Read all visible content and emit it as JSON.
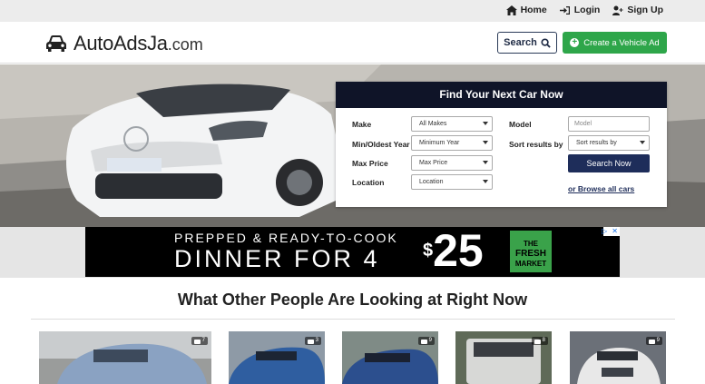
{
  "topbar": {
    "home": "Home",
    "login": "Login",
    "signup": "Sign Up"
  },
  "header": {
    "brand": "AutoAdsJa",
    "tld": ".com",
    "search_label": "Search",
    "create_label": "Create a Vehicle Ad"
  },
  "search_panel": {
    "title": "Find Your Next Car Now",
    "make_label": "Make",
    "make_value": "All Makes",
    "year_label": "Min/Oldest Year",
    "year_value": "Minimum Year",
    "price_label": "Max Price",
    "price_value": "Max Price",
    "location_label": "Location",
    "location_value": "Location",
    "model_label": "Model",
    "model_placeholder": "Model",
    "sort_label": "Sort results by",
    "sort_value": "Sort results by",
    "submit_label": "Search Now",
    "browse_label": "or Browse all cars"
  },
  "ad": {
    "line1": "PREPPED & READY-TO-COOK",
    "line2": "DINNER FOR 4",
    "price_symbol": "$",
    "price": "25",
    "badge_top": "THE",
    "badge_mid": "FRESH",
    "badge_bottom": "MARKET"
  },
  "section": {
    "title": "What Other People Are Looking at Right Now"
  },
  "listings": [
    {
      "photos": "7",
      "color": "#8aa2c2"
    },
    {
      "photos": "3",
      "color": "#2f5ea0"
    },
    {
      "photos": "9",
      "color": "#2c4f8e"
    },
    {
      "photos": "8",
      "color": "#d7d8d6"
    },
    {
      "photos": "9",
      "color": "#e8e8e8"
    }
  ]
}
